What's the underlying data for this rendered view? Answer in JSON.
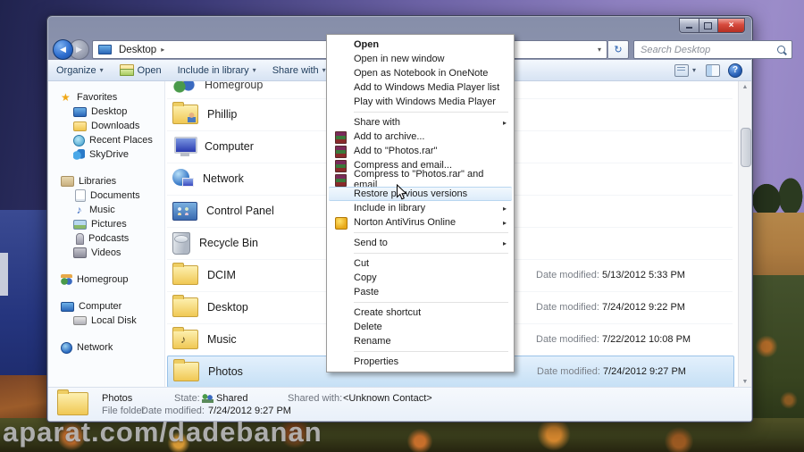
{
  "watermark": "aparat.com/dadebanan",
  "glyphs": {
    "back": "◀",
    "forward": "▶",
    "dropdown": "▾",
    "breadcrumb": "▸",
    "submenu": "▸",
    "refresh": "↻",
    "help": "?",
    "close": "×",
    "music_note": "♪",
    "star": "★",
    "scroll_up": "▲",
    "scroll_down": "▼"
  },
  "colors": {
    "selection": "#c6e0f5",
    "close_button": "#d6493c",
    "titlebar": "#8d95af",
    "menu_hover": "#dcecfa"
  },
  "address": {
    "location": "Desktop",
    "search_placeholder": "Search Desktop"
  },
  "toolbar": {
    "organize": "Organize",
    "open": "Open",
    "include": "Include in library",
    "share": "Share with"
  },
  "sidebar": {
    "favorites": {
      "label": "Favorites",
      "items": [
        "Desktop",
        "Downloads",
        "Recent Places",
        "SkyDrive"
      ]
    },
    "libraries": {
      "label": "Libraries",
      "items": [
        "Documents",
        "Music",
        "Pictures",
        "Podcasts",
        "Videos"
      ]
    },
    "homegroup": {
      "label": "Homegroup"
    },
    "computer": {
      "label": "Computer",
      "items": [
        "Local Disk"
      ]
    },
    "network": {
      "label": "Network"
    }
  },
  "date_label": "Date modified:",
  "files": [
    {
      "name": "Homegroup"
    },
    {
      "name": "Phillip"
    },
    {
      "name": "Computer"
    },
    {
      "name": "Network"
    },
    {
      "name": "Control Panel"
    },
    {
      "name": "Recycle Bin"
    },
    {
      "name": "DCIM",
      "date": "5/13/2012 5:33 PM"
    },
    {
      "name": "Desktop",
      "date": "7/24/2012 9:22 PM"
    },
    {
      "name": "Music",
      "date": "7/22/2012 10:08 PM"
    },
    {
      "name": "Photos",
      "date": "7/24/2012 9:27 PM"
    }
  ],
  "details": {
    "name": "Photos",
    "type": "File folder",
    "state_label": "State:",
    "state_value": "Shared",
    "modified_label": "Date modified:",
    "modified_value": "7/24/2012 9:27 PM",
    "shared_label": "Shared with:",
    "shared_value": "<Unknown Contact>"
  },
  "context_menu": {
    "items": [
      "Open",
      "Open in new window",
      "Open as Notebook in OneNote",
      "Add to Windows Media Player list",
      "Play with Windows Media Player",
      "Share with",
      "Add to archive...",
      "Add to \"Photos.rar\"",
      "Compress and email...",
      "Compress to \"Photos.rar\" and email",
      "Restore previous versions",
      "Include in library",
      "Norton AntiVirus Online",
      "Send to",
      "Cut",
      "Copy",
      "Paste",
      "Create shortcut",
      "Delete",
      "Rename",
      "Properties"
    ]
  }
}
